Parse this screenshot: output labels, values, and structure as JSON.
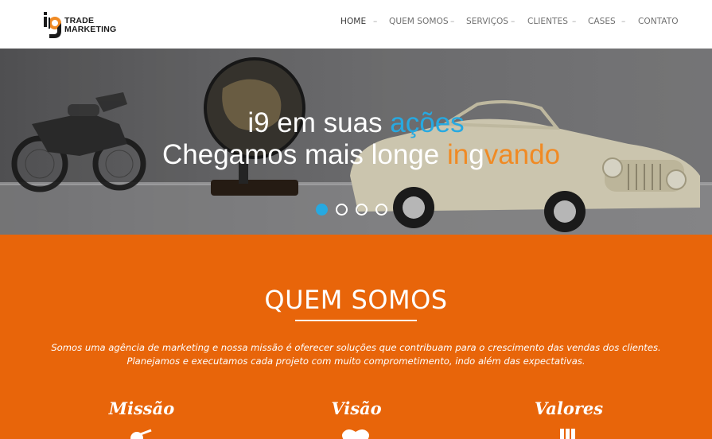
{
  "brand": {
    "logo_text_line1": "TRADE",
    "logo_text_line2": "MARKETING",
    "logo_mark": "i9"
  },
  "nav": {
    "items": [
      {
        "label": "HOME",
        "active": true
      },
      {
        "label": "QUEM SOMOS",
        "active": false
      },
      {
        "label": "SERVIÇOS",
        "active": false
      },
      {
        "label": "CLIENTES",
        "active": false
      },
      {
        "label": "CASES",
        "active": false
      },
      {
        "label": "CONTATO",
        "active": false
      }
    ],
    "separator": "–"
  },
  "hero": {
    "line1_part1": "i9 em suas ",
    "line1_highlight": "ações",
    "line2_part1": "Chegamos mais longe ",
    "line2_highlight_a": "in",
    "line2_highlight_b": "g",
    "line2_highlight_c": "vando",
    "slides": 4,
    "active_slide": 1,
    "accent_blue": "#27a9e1",
    "accent_orange": "#f08a24"
  },
  "about": {
    "title": "QUEM SOMOS",
    "text_line1": "Somos uma agência de marketing e nossa missão é oferecer soluções que contribuam para o crescimento das vendas dos clientes.",
    "text_line2": "Planejamos e executamos cada projeto com muito comprometimento, indo além das expectativas.",
    "columns": [
      {
        "title": "Missão",
        "icon": "target-icon"
      },
      {
        "title": "Visão",
        "icon": "heart-icon"
      },
      {
        "title": "Valores",
        "icon": "bars-icon"
      }
    ],
    "background": "#e8650a"
  }
}
